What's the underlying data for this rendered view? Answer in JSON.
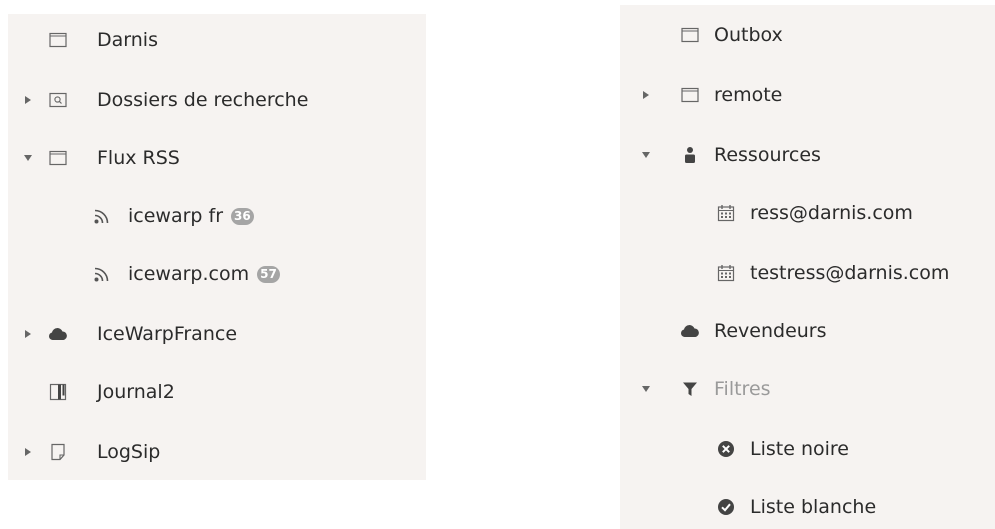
{
  "left_tree": {
    "items": [
      {
        "label": "Darnis",
        "icon": "folder-icon",
        "caret": "none"
      },
      {
        "label": "Dossiers de recherche",
        "icon": "search-folder-icon",
        "caret": "collapsed"
      },
      {
        "label": "Flux RSS",
        "icon": "folder-icon",
        "caret": "expanded"
      },
      {
        "label": "icewarp fr",
        "icon": "rss-icon",
        "caret": "none",
        "badge": "36"
      },
      {
        "label": "icewarp.com",
        "icon": "rss-icon",
        "caret": "none",
        "badge": "57"
      },
      {
        "label": "IceWarpFrance",
        "icon": "cloud-icon",
        "caret": "collapsed"
      },
      {
        "label": "Journal2",
        "icon": "journal-icon",
        "caret": "none"
      },
      {
        "label": "LogSip",
        "icon": "note-icon",
        "caret": "collapsed"
      }
    ]
  },
  "right_tree": {
    "items": [
      {
        "label": "Outbox",
        "icon": "folder-icon",
        "caret": "none"
      },
      {
        "label": "remote",
        "icon": "folder-icon",
        "caret": "collapsed"
      },
      {
        "label": "Ressources",
        "icon": "person-icon",
        "caret": "expanded"
      },
      {
        "label": "ress@darnis.com",
        "icon": "calendar-icon",
        "caret": "none"
      },
      {
        "label": "testress@darnis.com",
        "icon": "calendar-icon",
        "caret": "none"
      },
      {
        "label": "Revendeurs",
        "icon": "cloud-icon",
        "caret": "none"
      },
      {
        "label": "Filtres",
        "icon": "filter-icon",
        "caret": "expanded",
        "muted": true
      },
      {
        "label": "Liste noire",
        "icon": "blacklist-icon",
        "caret": "none"
      },
      {
        "label": "Liste blanche",
        "icon": "whitelist-icon",
        "caret": "none"
      }
    ]
  },
  "colors": {
    "panel_background": "#f6f3f1",
    "text": "#2b2b2b",
    "muted_text": "#9a9a9a",
    "icon": "#4a4a4a",
    "badge": "#a5a5a5"
  }
}
